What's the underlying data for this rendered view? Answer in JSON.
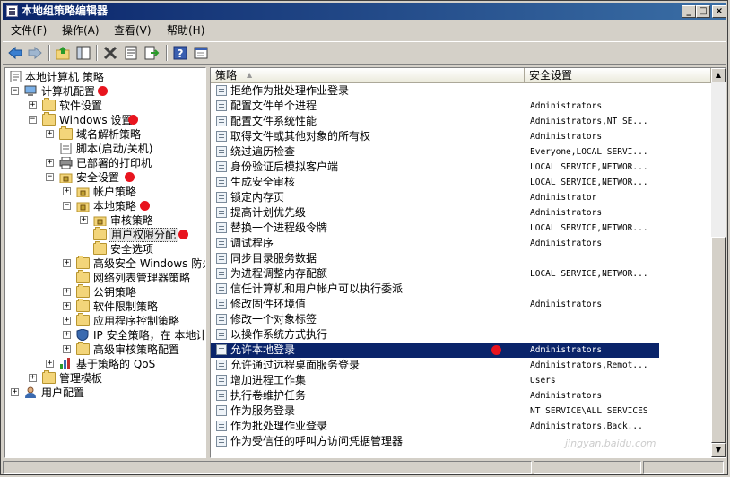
{
  "window": {
    "title": "本地组策略编辑器"
  },
  "menubar": [
    {
      "label": "文件(F)"
    },
    {
      "label": "操作(A)"
    },
    {
      "label": "查看(V)"
    },
    {
      "label": "帮助(H)"
    }
  ],
  "tree": {
    "root": "本地计算机 策略",
    "computer_config": "计算机配置",
    "software_settings": "软件设置",
    "windows_settings": "Windows 设置",
    "dns_policy": "域名解析策略",
    "scripts": "脚本(启动/关机)",
    "deployed_printers": "已部署的打印机",
    "security_settings": "安全设置",
    "account_policies": "帐户策略",
    "local_policies": "本地策略",
    "audit_policy": "审核策略",
    "user_rights": "用户权限分配",
    "security_options": "安全选项",
    "firewall": "高级安全 Windows 防火",
    "network_list": "网络列表管理器策略",
    "public_key": "公钥策略",
    "software_restriction": "软件限制策略",
    "app_control": "应用程序控制策略",
    "ipsec": "IP 安全策略，在 本地计",
    "advanced_audit": "高级审核策略配置",
    "qos": "基于策略的 QoS",
    "admin_templates": "管理模板",
    "user_config": "用户配置"
  },
  "columns": {
    "policy": "策略",
    "setting": "安全设置"
  },
  "rows": [
    {
      "name": "拒绝作为批处理作业登录",
      "value": ""
    },
    {
      "name": "配置文件单个进程",
      "value": "Administrators"
    },
    {
      "name": "配置文件系统性能",
      "value": "Administrators,NT SE..."
    },
    {
      "name": "取得文件或其他对象的所有权",
      "value": "Administrators"
    },
    {
      "name": "绕过遍历检查",
      "value": "Everyone,LOCAL SERVI..."
    },
    {
      "name": "身份验证后模拟客户端",
      "value": "LOCAL SERVICE,NETWOR..."
    },
    {
      "name": "生成安全审核",
      "value": "LOCAL SERVICE,NETWOR..."
    },
    {
      "name": "锁定内存页",
      "value": "Administrator"
    },
    {
      "name": "提高计划优先级",
      "value": "Administrators"
    },
    {
      "name": "替换一个进程级令牌",
      "value": "LOCAL SERVICE,NETWOR..."
    },
    {
      "name": "调试程序",
      "value": "Administrators"
    },
    {
      "name": "同步目录服务数据",
      "value": ""
    },
    {
      "name": "为进程调整内存配额",
      "value": "LOCAL SERVICE,NETWOR..."
    },
    {
      "name": "信任计算机和用户帐户可以执行委派",
      "value": ""
    },
    {
      "name": "修改固件环境值",
      "value": "Administrators"
    },
    {
      "name": "修改一个对象标签",
      "value": ""
    },
    {
      "name": "以操作系统方式执行",
      "value": ""
    },
    {
      "name": "允许本地登录",
      "value": "Administrators"
    },
    {
      "name": "允许通过远程桌面服务登录",
      "value": "Administrators,Remot..."
    },
    {
      "name": "增加进程工作集",
      "value": "Users"
    },
    {
      "name": "执行卷维护任务",
      "value": "Administrators"
    },
    {
      "name": "作为服务登录",
      "value": "NT SERVICE\\ALL SERVICES"
    },
    {
      "name": "作为批处理作业登录",
      "value": "Administrators,Back..."
    },
    {
      "name": "作为受信任的呼叫方访问凭据管理器",
      "value": ""
    }
  ],
  "selected_row": 17,
  "watermark": "jingyan.baidu.com",
  "colors": {
    "selection": "#0a246a",
    "mark": "#e8141e"
  }
}
